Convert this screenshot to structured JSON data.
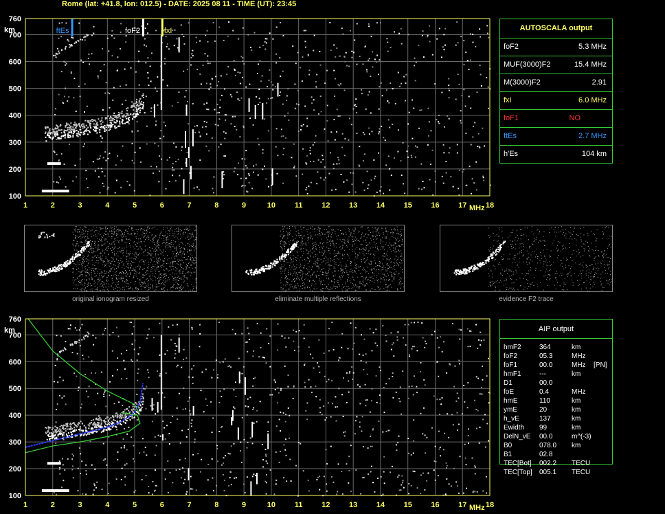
{
  "header": "Rome (lat: +41.8, lon: 012.5) - DATE: 2025 08 11 - TIME (UT): 23:45",
  "axes": {
    "y_unit": "km",
    "x_unit": "MHz",
    "y_ticks": [
      "100",
      "200",
      "300",
      "400",
      "500",
      "600",
      "700",
      "760"
    ],
    "x_ticks": [
      "1",
      "2",
      "3",
      "4",
      "5",
      "6",
      "7",
      "8",
      "9",
      "10",
      "11",
      "12",
      "13",
      "14",
      "15",
      "16",
      "17",
      "18"
    ]
  },
  "markers": {
    "ftEs": {
      "label": "ftEs",
      "freq": 2.7,
      "color": "#3399ff"
    },
    "foF2": {
      "label": "foF2",
      "freq": 5.3,
      "color": "#ffffff"
    },
    "fxI": {
      "label": "fxI",
      "freq": 6.0,
      "color": "#ffff66"
    }
  },
  "autoscala": {
    "title": "AUTOSCALA output",
    "rows": [
      {
        "label": "foF2",
        "value": "5.3 MHz",
        "color": "#ffffff"
      },
      {
        "label": "MUF(3000)F2",
        "value": "15.4 MHz",
        "color": "#ffffff"
      },
      {
        "label": "M(3000)F2",
        "value": "2.91",
        "color": "#ffffff"
      },
      {
        "label": "fxI",
        "value": "6.0 MHz",
        "color": "#ffff66"
      },
      {
        "label": "foF1",
        "value": "NO",
        "color": "#ff3333"
      },
      {
        "label": "ftEs",
        "value": "2.7 MHz",
        "color": "#3399ff"
      },
      {
        "label": "h'Es",
        "value": "104    km",
        "color": "#ffffff"
      }
    ]
  },
  "thumbnails": [
    {
      "caption": "original ionogram resized"
    },
    {
      "caption": "eliminate multiple reflections"
    },
    {
      "caption": "evidence F2 trace"
    }
  ],
  "aip": {
    "title": "AIP output",
    "rows": [
      [
        "hmF2",
        "364",
        "km",
        ""
      ],
      [
        "foF2",
        "05.3",
        "MHz",
        ""
      ],
      [
        "foF1",
        "00.0",
        "MHz",
        "[PN]"
      ],
      [
        "hmF1",
        "---",
        "km",
        ""
      ],
      [
        "D1",
        "00.0",
        "",
        ""
      ],
      [
        "foE",
        "0.4",
        "MHz",
        ""
      ],
      [
        "hmE",
        "110",
        "km",
        ""
      ],
      [
        "ymE",
        "20",
        "km",
        ""
      ],
      [
        "h_vE",
        "137",
        "km",
        ""
      ],
      [
        "Ewidth",
        "99",
        "km",
        ""
      ],
      [
        "DelN_vE",
        "00.0",
        "m^(-3)",
        ""
      ],
      [
        "B0",
        "078.0",
        "km",
        ""
      ],
      [
        "B1",
        "02.8",
        "",
        ""
      ],
      [
        "TEC[Bot]",
        "002.2",
        "TECU",
        ""
      ],
      [
        "TEC[Top]",
        "005.1",
        "TECU",
        ""
      ]
    ]
  },
  "chart_data": [
    {
      "type": "scatter",
      "title": "",
      "xlabel": "MHz",
      "ylabel": "km",
      "xlim": [
        1,
        18
      ],
      "ylim": [
        100,
        760
      ],
      "grid": true,
      "series": [
        {
          "values": [
            [
              1.7,
              310
            ],
            [
              2.0,
              315
            ],
            [
              2.5,
              322
            ],
            [
              3.0,
              330
            ],
            [
              3.5,
              338
            ],
            [
              4.0,
              350
            ],
            [
              4.5,
              368
            ],
            [
              4.8,
              385
            ],
            [
              5.0,
              400
            ],
            [
              5.2,
              420
            ],
            [
              5.3,
              440
            ]
          ]
        },
        {
          "values": [
            [
              1.8,
              220
            ],
            [
              2.3,
              220
            ]
          ]
        },
        {
          "values": [
            [
              1.6,
              118
            ],
            [
              2.6,
              120
            ]
          ]
        }
      ]
    },
    {
      "type": "line",
      "title": "",
      "xlabel": "MHz",
      "ylabel": "km",
      "xlim": [
        1,
        18
      ],
      "ylim": [
        100,
        760
      ],
      "grid": true,
      "series": [
        {
          "values": [
            [
              1.0,
              280
            ],
            [
              2.0,
              305
            ],
            [
              3.0,
              330
            ],
            [
              4.0,
              355
            ],
            [
              4.5,
              375
            ],
            [
              5.0,
              410
            ],
            [
              5.2,
              450
            ],
            [
              5.3,
              520
            ]
          ]
        },
        {
          "values": [
            [
              1.1,
              760
            ],
            [
              2.0,
              640
            ],
            [
              3.0,
              555
            ],
            [
              4.0,
              490
            ],
            [
              5.0,
              440
            ],
            [
              5.2,
              400
            ]
          ]
        },
        {
          "values": [
            [
              1.0,
              260
            ],
            [
              2.0,
              285
            ],
            [
              3.0,
              300
            ],
            [
              4.0,
              320
            ],
            [
              4.8,
              340
            ],
            [
              5.2,
              370
            ],
            [
              5.1,
              400
            ],
            [
              4.5,
              410
            ]
          ]
        }
      ]
    }
  ]
}
